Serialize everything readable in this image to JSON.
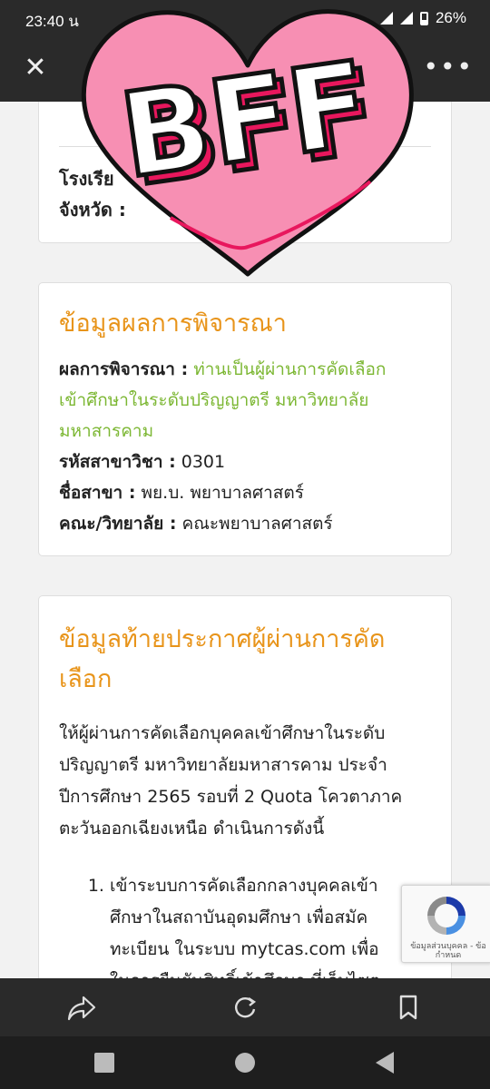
{
  "status_bar": {
    "time": "23:40 น",
    "battery": "26%"
  },
  "toolbar": {
    "title_fragment": "ู...",
    "close_icon": "close-icon",
    "more_icon": "more-vert-icon"
  },
  "card1": {
    "line1_label": "โรงเรีย",
    "line2_label": "จังหวัด :"
  },
  "card2": {
    "title": "ข้อมูลผลการพิจารณา",
    "result_label": "ผลการพิจารณา :",
    "result_line1": "ท่านเป็นผู้ผ่านการคัดเลือก",
    "result_line2": "เข้าศึกษาในระดับปริญญาตรี มหาวิทยาลัย",
    "result_line3": "มหาสารคาม",
    "code_label": "รหัสสาขาวิชา :",
    "code_value": "0301",
    "major_label": "ชื่อสาขา :",
    "major_value": "พย.บ. พยาบาลศาสตร์",
    "faculty_label": "คณะ/วิทยาลัย :",
    "faculty_value": "คณะพยาบาลศาสตร์"
  },
  "card3": {
    "title_line1": "ข้อมูลท้ายประกาศผู้ผ่านการคัด",
    "title_line2": "เลือก",
    "para_line1": "ให้ผู้ผ่านการคัดเลือกบุคคลเข้าศึกษาในระดับ",
    "para_line2": "ปริญญาตรี มหาวิทยาลัยมหาสารคาม ประจำ",
    "para_line3": "ปีการศึกษา 2565 รอบที่ 2 Quota โควตาภาค",
    "para_line4": "ตะวันออกเฉียงเหนือ ดำเนินการดังนี้",
    "step1_line1": "เข้าระบบการคัดเลือกกลางบุคคลเข้า",
    "step1_line2": "ศึกษาในสถาบันอุดมศึกษา เพื่อสมัค",
    "step1_line3": "ทะเบียน ในระบบ mytcas.com เพื่อ",
    "step1_line4": "ในการยืนยันสิทธิ์เข้าศึกษา ที่เว็บไซต"
  },
  "recaptcha": {
    "text": "ข้อมูลส่วนบุคคล - ข้อกำหนด"
  },
  "sticker": {
    "text": "BFF",
    "heart_color": "#f78fb3",
    "shadow_color": "#e8175d"
  },
  "colors": {
    "accent_orange": "#e8941a",
    "result_green": "#7cb733",
    "bar_dark": "#2a2a2a"
  }
}
